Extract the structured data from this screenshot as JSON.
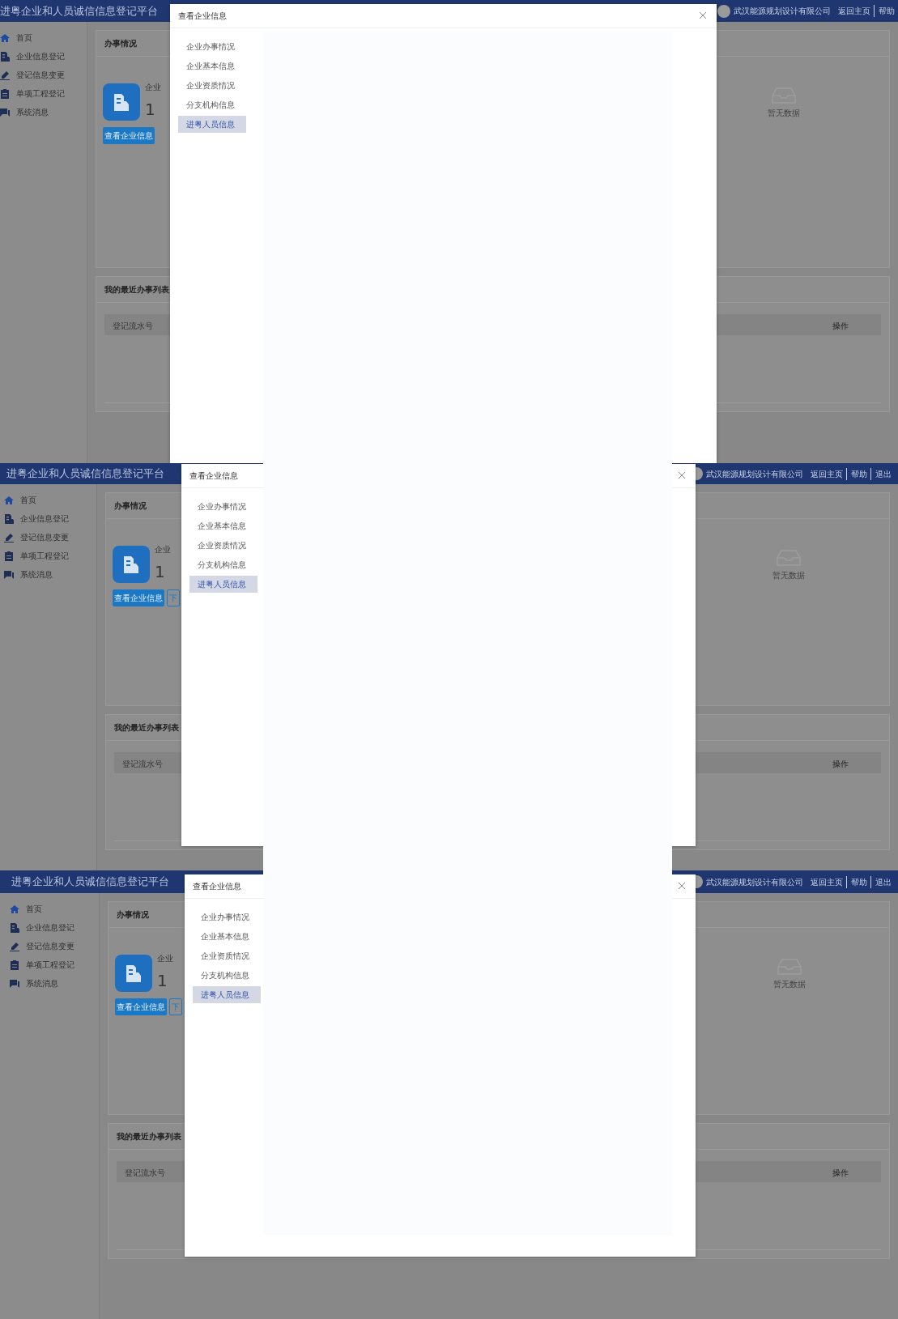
{
  "frames": [
    {
      "header": {
        "title": "进粤企业和人员诚信信息登记平台",
        "company": "武汉能源规划设计有限公司",
        "links": [
          "返回主页",
          "帮助"
        ]
      },
      "sidebar": {
        "items": [
          {
            "kind": "home",
            "label": "首页"
          },
          {
            "kind": "building",
            "label": "企业信息登记"
          },
          {
            "kind": "pen",
            "label": "登记信息变更"
          },
          {
            "kind": "clipboard",
            "label": "单项工程登记"
          },
          {
            "kind": "chat",
            "label": "系统消息"
          }
        ]
      },
      "status_card": {
        "title": "办事情况",
        "label": "企业",
        "count": "1",
        "button": "查看企业信息",
        "empty_text": "暂无数据"
      },
      "recent_card": {
        "title": "我的最近办事列表",
        "columns": [
          "登记流水号",
          "操作"
        ]
      },
      "modal": {
        "title": "查看企业信息",
        "nav": [
          {
            "label": "企业办事情况",
            "selected": false
          },
          {
            "label": "企业基本信息",
            "selected": false
          },
          {
            "label": "企业资质情况",
            "selected": false
          },
          {
            "label": "分支机构信息",
            "selected": false
          },
          {
            "label": "进粤人员信息",
            "selected": true
          }
        ]
      }
    },
    {
      "header": {
        "title": "进粤企业和人员诚信信息登记平台",
        "company": "武汉能源规划设计有限公司",
        "links": [
          "返回主页",
          "帮助",
          "退出"
        ]
      },
      "sidebar": {
        "items": [
          {
            "kind": "home",
            "label": "首页"
          },
          {
            "kind": "building",
            "label": "企业信息登记"
          },
          {
            "kind": "pen",
            "label": "登记信息变更"
          },
          {
            "kind": "clipboard",
            "label": "单项工程登记"
          },
          {
            "kind": "chat",
            "label": "系统消息"
          }
        ]
      },
      "status_card": {
        "title": "办事情况",
        "label": "企业",
        "count": "1",
        "button": "查看企业信息",
        "second_button": "下",
        "empty_text": "暂无数据"
      },
      "recent_card": {
        "title": "我的最近办事列表",
        "columns": [
          "登记流水号",
          "操作"
        ]
      },
      "modal": {
        "title": "查看企业信息",
        "nav": [
          {
            "label": "企业办事情况",
            "selected": false
          },
          {
            "label": "企业基本信息",
            "selected": false
          },
          {
            "label": "企业资质情况",
            "selected": false
          },
          {
            "label": "分支机构信息",
            "selected": false
          },
          {
            "label": "进粤人员信息",
            "selected": true
          }
        ]
      }
    },
    {
      "header": {
        "title": "进粤企业和人员诚信信息登记平台",
        "company": "武汉能源规划设计有限公司",
        "links": [
          "返回主页",
          "帮助",
          "退出"
        ]
      },
      "sidebar": {
        "items": [
          {
            "kind": "home",
            "label": "首页"
          },
          {
            "kind": "building",
            "label": "企业信息登记"
          },
          {
            "kind": "pen",
            "label": "登记信息变更"
          },
          {
            "kind": "clipboard",
            "label": "单项工程登记"
          },
          {
            "kind": "chat",
            "label": "系统消息"
          }
        ]
      },
      "status_card": {
        "title": "办事情况",
        "label": "企业",
        "count": "1",
        "button": "查看企业信息",
        "second_button": "下",
        "empty_text": "暂无数据"
      },
      "recent_card": {
        "title": "我的最近办事列表",
        "columns": [
          "登记流水号",
          "操作"
        ]
      },
      "modal": {
        "title": "查看企业信息",
        "nav": [
          {
            "label": "企业办事情况",
            "selected": false
          },
          {
            "label": "企业基本信息",
            "selected": false
          },
          {
            "label": "企业资质情况",
            "selected": false
          },
          {
            "label": "分支机构信息",
            "selected": false
          },
          {
            "label": "进粤人员信息",
            "selected": true
          }
        ]
      }
    }
  ]
}
